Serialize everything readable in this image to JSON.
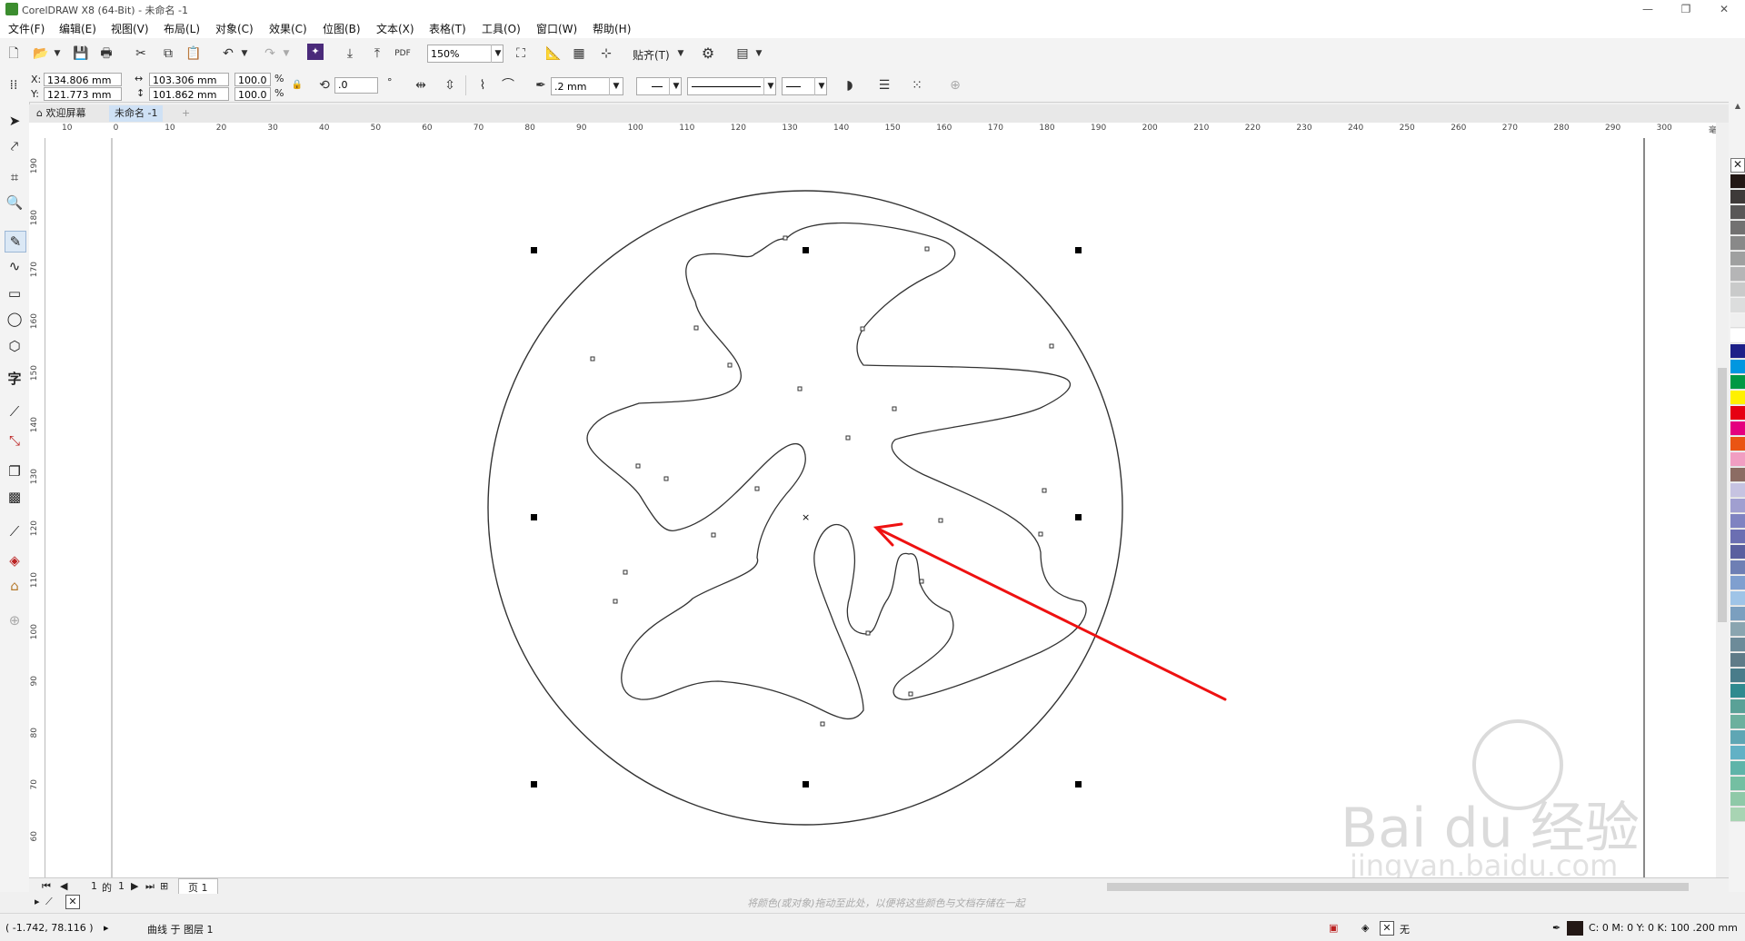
{
  "window": {
    "title": "CorelDRAW X8 (64-Bit) - 未命名 -1",
    "minimize": "—",
    "restore": "❐",
    "close": "✕"
  },
  "menu": [
    "文件(F)",
    "编辑(E)",
    "视图(V)",
    "布局(L)",
    "对象(C)",
    "效果(C)",
    "位图(B)",
    "文本(X)",
    "表格(T)",
    "工具(O)",
    "窗口(W)",
    "帮助(H)"
  ],
  "standard_toolbar": {
    "zoom": "150%",
    "snap_label": "贴齐(T)"
  },
  "property_bar": {
    "x_label": "X:",
    "x_value": "134.806 mm",
    "y_label": "Y:",
    "y_value": "121.773 mm",
    "width_value": "103.306 mm",
    "height_value": "101.862 mm",
    "scale_x": "100.0",
    "scale_y": "100.0",
    "percent": "%",
    "rotation": ".0",
    "degree": "°",
    "outline_width": ".2 mm"
  },
  "tabs": {
    "welcome": "欢迎屏幕",
    "document": "未命名 -1",
    "add": "+"
  },
  "hruler_ticks": [
    "10",
    "0",
    "10",
    "20",
    "30",
    "40",
    "50",
    "60",
    "70",
    "80",
    "90",
    "100",
    "110",
    "120",
    "130",
    "140",
    "150",
    "160",
    "170",
    "180",
    "190",
    "200",
    "210",
    "220",
    "230",
    "240",
    "250",
    "260",
    "270",
    "280",
    "290",
    "300",
    "毫米"
  ],
  "vruler_ticks": [
    "190",
    "180",
    "170",
    "160",
    "150",
    "140",
    "130",
    "120",
    "110",
    "100",
    "90",
    "80",
    "70",
    "60"
  ],
  "page_nav": {
    "current": "1",
    "of": "的",
    "total": "1",
    "page_tab": "页 1"
  },
  "color_hint": "将颜色(或对象)拖动至此处，以便将这些颜色与文档存储在一起",
  "status": {
    "coords": "( -1.742, 78.116 )",
    "object_info": "曲线 于 图层 1",
    "fill_none": "无",
    "outline_info": "C: 0 M: 0 Y: 0 K: 100  .200 mm"
  },
  "watermark": {
    "brand": "Bai du 经验",
    "url": "jingyan.baidu.com"
  },
  "colors": {
    "accent_arrow": "#ee1111",
    "palette": [
      "#231815",
      "#3e3a39",
      "#595757",
      "#727171",
      "#898989",
      "#9fa0a0",
      "#b5b5b6",
      "#c9caca",
      "#dcdddd",
      "#efefef",
      "#ffffff",
      "#1d2088",
      "#0097e0",
      "#009944",
      "#fff100",
      "#e60012",
      "#e4007f",
      "#ea5413",
      "#f19ec2",
      "#8c6c63",
      "#c6c3e1",
      "#a09fd0",
      "#7f83c1",
      "#6b6fb2",
      "#5a5f9f",
      "#6e7fb4",
      "#7f9fcf",
      "#9fc4e7",
      "#7b9fbf",
      "#8aa5b0",
      "#6d8b99",
      "#5f7b88",
      "#497c8a",
      "#2f8a8f",
      "#5aa197",
      "#6cb09e",
      "#5fa6b4",
      "#62b1c5",
      "#5fb4a9",
      "#74bfa2",
      "#8fc9a8",
      "#a8d4b3"
    ]
  }
}
